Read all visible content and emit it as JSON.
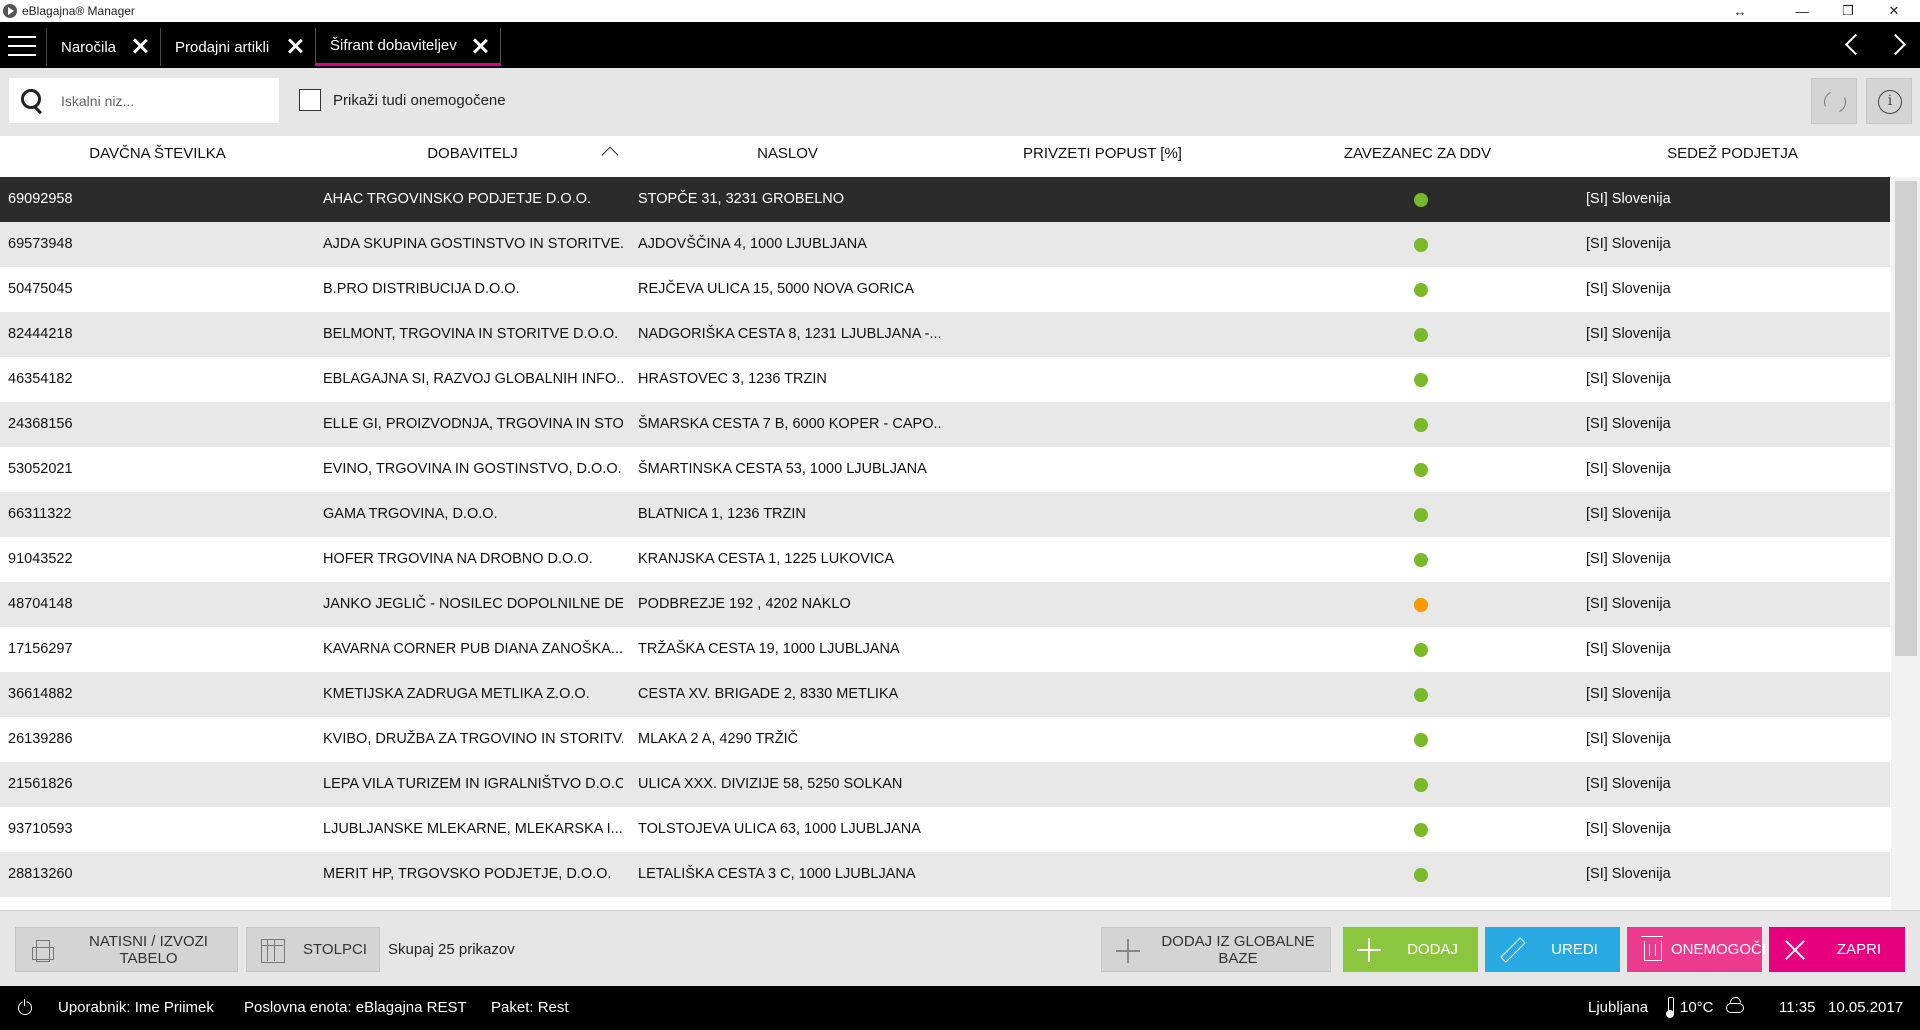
{
  "window": {
    "title": "eBlagajna® Manager",
    "controls": {
      "resize": "↔",
      "minimize": "—",
      "restore": "❐",
      "close": "✕"
    }
  },
  "tabs": [
    {
      "label": "Naročila",
      "active": false
    },
    {
      "label": "Prodajni artikli",
      "active": false
    },
    {
      "label": "Šifrant dobaviteljev",
      "active": true
    }
  ],
  "toolbar": {
    "search_placeholder": "Iskalni niz...",
    "search_value": "",
    "show_disabled_label": "Prikaži tudi onemogočene",
    "show_disabled_checked": false
  },
  "columns": [
    "DAVČNA ŠTEVILKA",
    "DOBAVITELJ",
    "NASLOV",
    "PRIVZETI POPUST [%]",
    "ZAVEZANEC ZA DDV",
    "SEDEŽ PODJETJA"
  ],
  "sort": {
    "column": "DOBAVITELJ",
    "direction": "ascending"
  },
  "colors": {
    "accent": "#e6007e",
    "vat_yes": "#7ab929",
    "vat_partial": "#ff9900",
    "add": "#8cc63f",
    "edit": "#29a9e1",
    "disable": "#ec3a8e",
    "close": "#e6007e"
  },
  "rows": [
    {
      "tax": "69092958",
      "supplier": "AHAC TRGOVINSKO PODJETJE D.O.O.",
      "address": "STOPČE 31, 3231 GROBELNO",
      "discount": "",
      "vat": "yes",
      "seat": "[SI] Slovenija"
    },
    {
      "tax": "69573948",
      "supplier": "AJDA SKUPINA GOSTINSTVO IN STORITVE...",
      "address": "AJDOVŠČINA 4, 1000 LJUBLJANA",
      "discount": "",
      "vat": "yes",
      "seat": "[SI] Slovenija"
    },
    {
      "tax": "50475045",
      "supplier": "B.PRO DISTRIBUCIJA D.O.O.",
      "address": "REJČEVA ULICA 15, 5000 NOVA GORICA",
      "discount": "",
      "vat": "yes",
      "seat": "[SI] Slovenija"
    },
    {
      "tax": "82444218",
      "supplier": "BELMONT, TRGOVINA IN STORITVE D.O.O.",
      "address": "NADGORIŠKA CESTA 8, 1231 LJUBLJANA -...",
      "discount": "",
      "vat": "yes",
      "seat": "[SI] Slovenija"
    },
    {
      "tax": "46354182",
      "supplier": "EBLAGAJNA SI, RAZVOJ GLOBALNIH INFO...",
      "address": "HRASTOVEC 3, 1236 TRZIN",
      "discount": "",
      "vat": "yes",
      "seat": "[SI] Slovenija"
    },
    {
      "tax": "24368156",
      "supplier": "ELLE GI, PROIZVODNJA, TRGOVINA IN STO...",
      "address": "ŠMARSKA CESTA 7 B, 6000 KOPER - CAPO...",
      "discount": "",
      "vat": "yes",
      "seat": "[SI] Slovenija"
    },
    {
      "tax": "53052021",
      "supplier": "EVINO, TRGOVINA IN GOSTINSTVO, D.O.O.",
      "address": "ŠMARTINSKA CESTA 53, 1000 LJUBLJANA",
      "discount": "",
      "vat": "yes",
      "seat": "[SI] Slovenija"
    },
    {
      "tax": "66311322",
      "supplier": "GAMA TRGOVINA, D.O.O.",
      "address": "BLATNICA 1, 1236 TRZIN",
      "discount": "",
      "vat": "yes",
      "seat": "[SI] Slovenija"
    },
    {
      "tax": "91043522",
      "supplier": "HOFER TRGOVINA NA DROBNO D.O.O.",
      "address": "KRANJSKA CESTA 1, 1225 LUKOVICA",
      "discount": "",
      "vat": "yes",
      "seat": "[SI] Slovenija"
    },
    {
      "tax": "48704148",
      "supplier": "JANKO JEGLIČ - NOSILEC DOPOLNILNE DE...",
      "address": "PODBREZJE 192 , 4202 NAKLO",
      "discount": "",
      "vat": "partial",
      "seat": "[SI] Slovenija"
    },
    {
      "tax": "17156297",
      "supplier": "KAVARNA CORNER PUB DIANA ZANOŠKA...",
      "address": "TRŽAŠKA CESTA 19, 1000 LJUBLJANA",
      "discount": "",
      "vat": "yes",
      "seat": "[SI] Slovenija"
    },
    {
      "tax": "36614882",
      "supplier": "KMETIJSKA ZADRUGA METLIKA Z.O.O.",
      "address": "CESTA XV. BRIGADE 2, 8330 METLIKA",
      "discount": "",
      "vat": "yes",
      "seat": "[SI] Slovenija"
    },
    {
      "tax": "26139286",
      "supplier": "KVIBO, DRUŽBA ZA TRGOVINO IN STORITV...",
      "address": "MLAKA 2 A, 4290 TRŽIČ",
      "discount": "",
      "vat": "yes",
      "seat": "[SI] Slovenija"
    },
    {
      "tax": "21561826",
      "supplier": "LEPA VILA TURIZEM IN IGRALNIŠTVO D.O.O.",
      "address": "ULICA XXX. DIVIZIJE 58, 5250 SOLKAN",
      "discount": "",
      "vat": "yes",
      "seat": "[SI] Slovenija"
    },
    {
      "tax": "93710593",
      "supplier": "LJUBLJANSKE MLEKARNE, MLEKARSKA I...",
      "address": "TOLSTOJEVA ULICA 63, 1000 LJUBLJANA",
      "discount": "",
      "vat": "yes",
      "seat": "[SI] Slovenija"
    },
    {
      "tax": "28813260",
      "supplier": "MERIT HP, TRGOVSKO PODJETJE, D.O.O.",
      "address": "LETALIŠKA CESTA 3 C, 1000 LJUBLJANA",
      "discount": "",
      "vat": "yes",
      "seat": "[SI] Slovenija"
    }
  ],
  "actions": {
    "print": "NATISNI / IZVOZI TABELO",
    "columns": "STOLPCI",
    "total": "Skupaj 25 prikazov",
    "add_global": "DODAJ IZ GLOBALNE BAZE",
    "add": "DODAJ",
    "edit": "UREDI",
    "disable": "ONEMOGOČI",
    "close": "ZAPRI"
  },
  "status": {
    "user": "Uporabnik: Ime Priimek",
    "unit": "Poslovna enota: eBlagajna REST",
    "package": "Paket: Rest",
    "city": "Ljubljana",
    "temperature": "10°C",
    "time": "11:35",
    "date": "10.05.2017"
  }
}
